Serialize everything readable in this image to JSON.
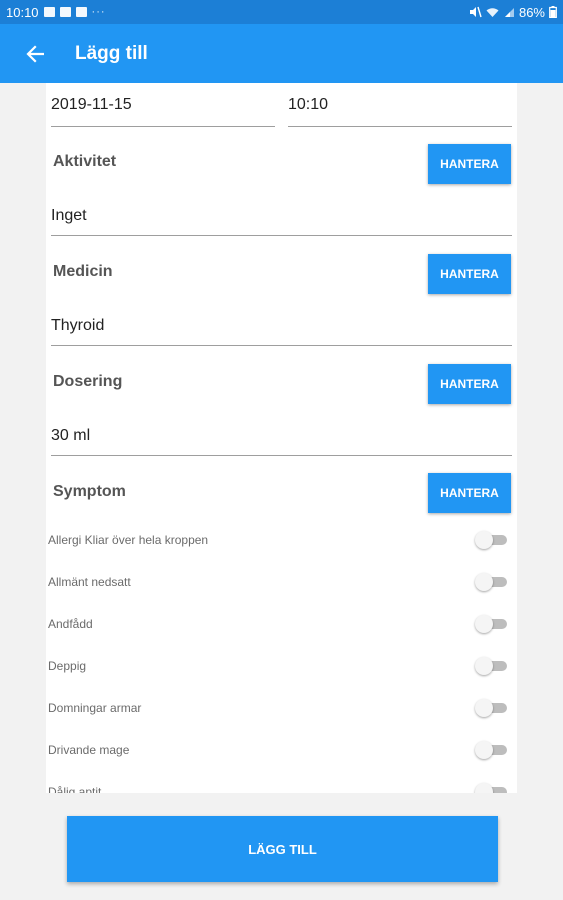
{
  "status_bar": {
    "time": "10:10",
    "battery": "86%"
  },
  "app_bar": {
    "title": "Lägg till",
    "back_icon": "arrow-back-icon"
  },
  "form": {
    "date": "2019-11-15",
    "time": "10:10",
    "sections": [
      {
        "label": "Aktivitet",
        "button": "HANTERA",
        "value": "Inget"
      },
      {
        "label": "Medicin",
        "button": "HANTERA",
        "value": "Thyroid"
      },
      {
        "label": "Dosering",
        "button": "HANTERA",
        "value": "30 ml"
      },
      {
        "label": "Symptom",
        "button": "HANTERA"
      }
    ],
    "symptoms": [
      {
        "label": "Allergi Kliar över hela kroppen",
        "on": false
      },
      {
        "label": "Allmänt nedsatt",
        "on": false
      },
      {
        "label": "Andfådd",
        "on": false
      },
      {
        "label": "Deppig",
        "on": false
      },
      {
        "label": "Domningar armar",
        "on": false
      },
      {
        "label": "Drivande mage",
        "on": false
      },
      {
        "label": "Dålig aptit",
        "on": false
      }
    ]
  },
  "submit_label": "LÄGG TILL",
  "colors": {
    "status_bar": "#1c7fd6",
    "app_bar": "#2196f3",
    "button": "#2196f3",
    "background": "#f2f2f2"
  }
}
